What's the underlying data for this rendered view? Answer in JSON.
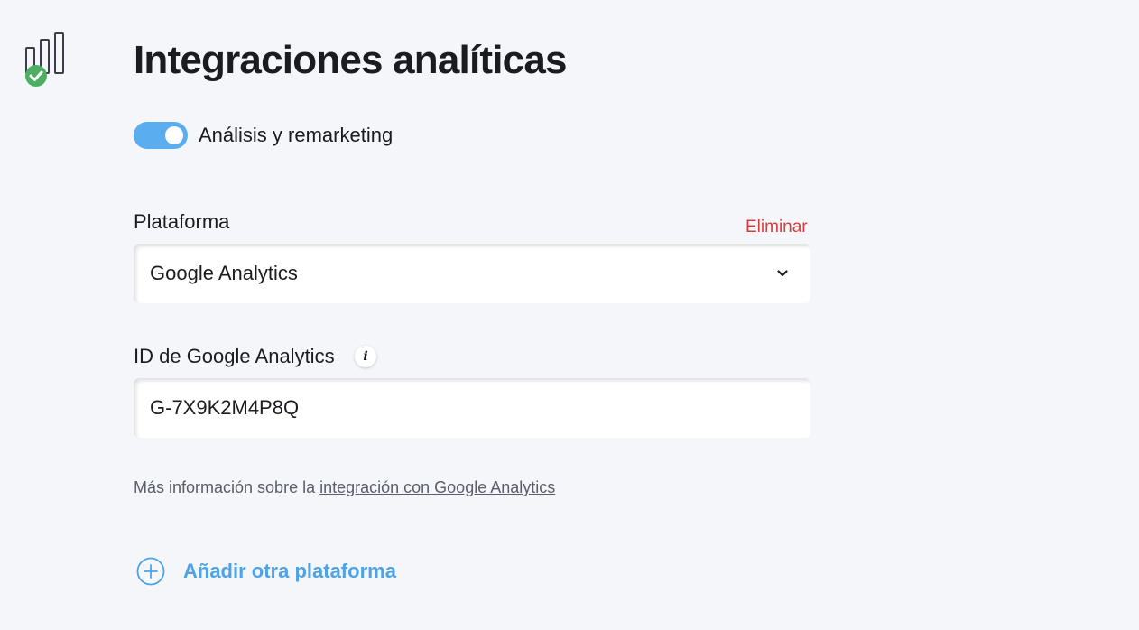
{
  "header": {
    "title": "Integraciones analíticas",
    "icon": "analytics-check-icon"
  },
  "toggle": {
    "label": "Análisis y remarketing",
    "enabled": true
  },
  "platform": {
    "label": "Plataforma",
    "remove_label": "Eliminar",
    "selected": "Google Analytics"
  },
  "tracking_id": {
    "label": "ID de Google Analytics",
    "value": "G-7X9K2M4P8Q"
  },
  "help": {
    "prefix": "Más información sobre la ",
    "link_text": "integración con Google Analytics"
  },
  "add_platform": {
    "label": "Añadir otra plataforma"
  },
  "colors": {
    "accent": "#4ea3e6",
    "toggle_on": "#5aaef0",
    "danger": "#dc3a3a",
    "success": "#4caf63",
    "background": "#f5f6fa"
  }
}
